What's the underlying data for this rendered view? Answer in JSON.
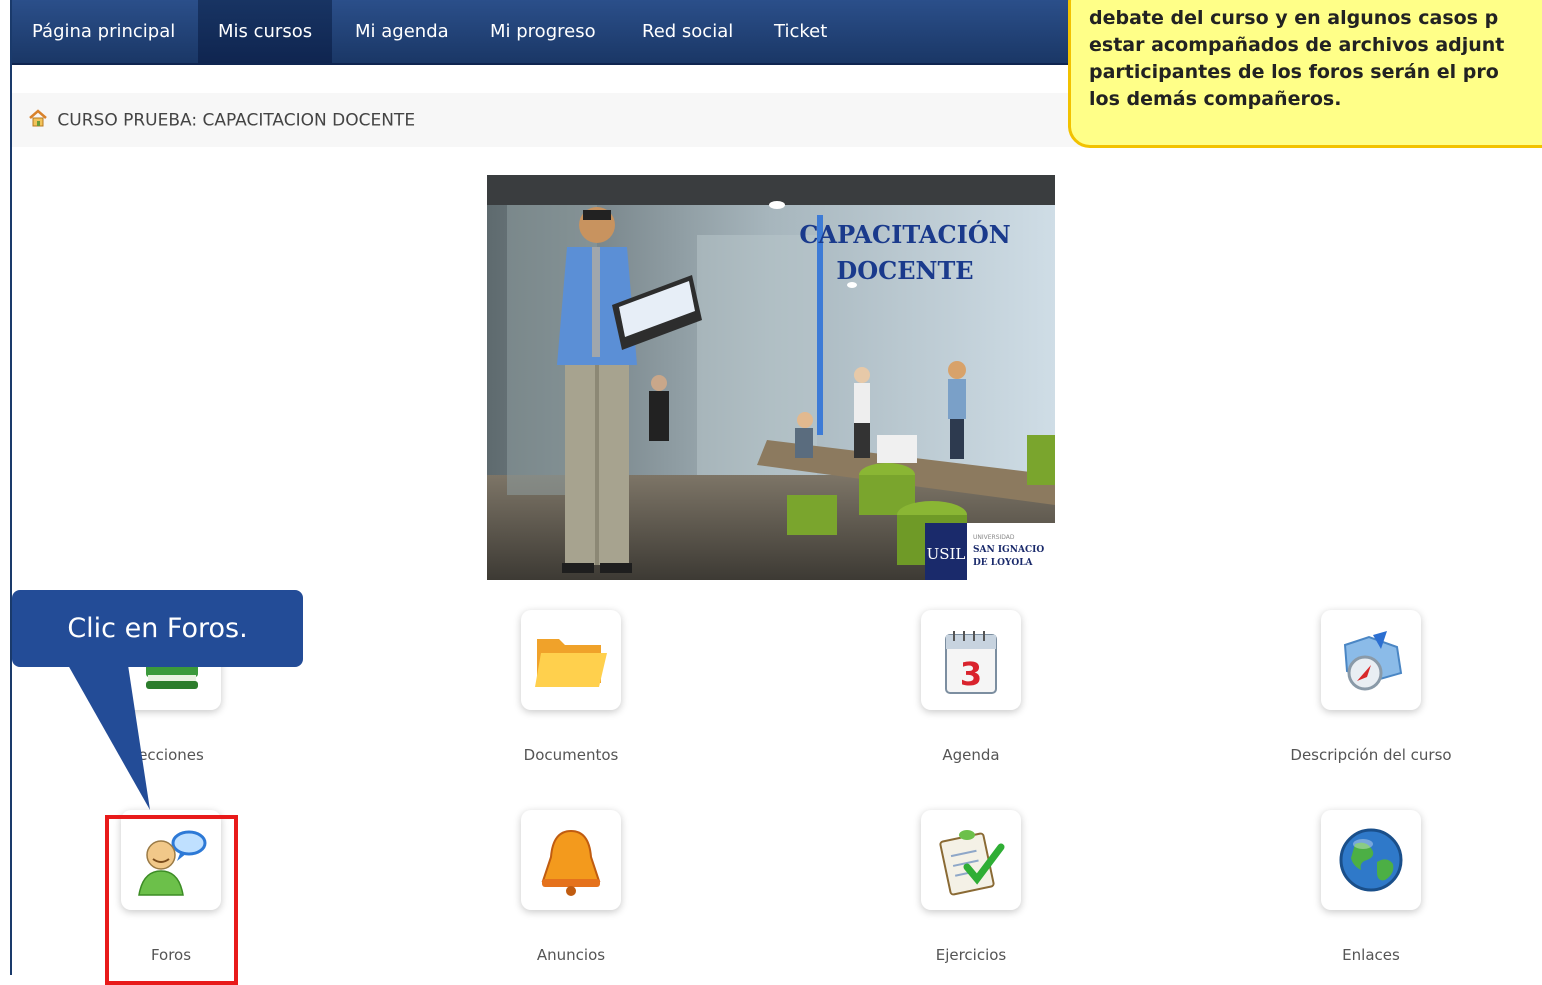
{
  "nav": {
    "items": [
      {
        "label": "Página principal",
        "active": false
      },
      {
        "label": "Mis cursos",
        "active": true
      },
      {
        "label": "Mi agenda",
        "active": false
      },
      {
        "label": "Mi progreso",
        "active": false
      },
      {
        "label": "Red social",
        "active": false
      },
      {
        "label": "Ticket",
        "active": false
      }
    ]
  },
  "breadcrumb": {
    "icon": "home-icon",
    "text": "CURSO PRUEBA: CAPACITACION DOCENTE"
  },
  "banner": {
    "title_line1": "CAPACITACIÓN",
    "title_line2": "DOCENTE",
    "logo_mark": "USIL",
    "logo_small": "UNIVERSIDAD",
    "logo_line1": "SAN IGNACIO",
    "logo_line2": "DE LOYOLA"
  },
  "tools": [
    {
      "label": "ecciones",
      "icon": "book-icon"
    },
    {
      "label": "Documentos",
      "icon": "folder-icon"
    },
    {
      "label": "Agenda",
      "icon": "calendar-icon"
    },
    {
      "label": "Descripción del curso",
      "icon": "compass-map-icon"
    },
    {
      "label": "Foros",
      "icon": "forum-user-icon"
    },
    {
      "label": "Anuncios",
      "icon": "bell-icon"
    },
    {
      "label": "Ejercicios",
      "icon": "checklist-icon"
    },
    {
      "label": "Enlaces",
      "icon": "globe-icon"
    }
  ],
  "callout": {
    "text": "Clic en Foros."
  },
  "tooltip": {
    "lines": [
      "debate del curso y en algunos casos p",
      "estar acompañados de archivos adjunt",
      "participantes de los foros serán el pro",
      "los demás compañeros."
    ]
  },
  "colors": {
    "nav": "#1f3f78",
    "callout": "#234c97",
    "tooltip_bg": "#ffff88",
    "tooltip_border": "#f2c200",
    "highlight": "#e81a1a"
  }
}
